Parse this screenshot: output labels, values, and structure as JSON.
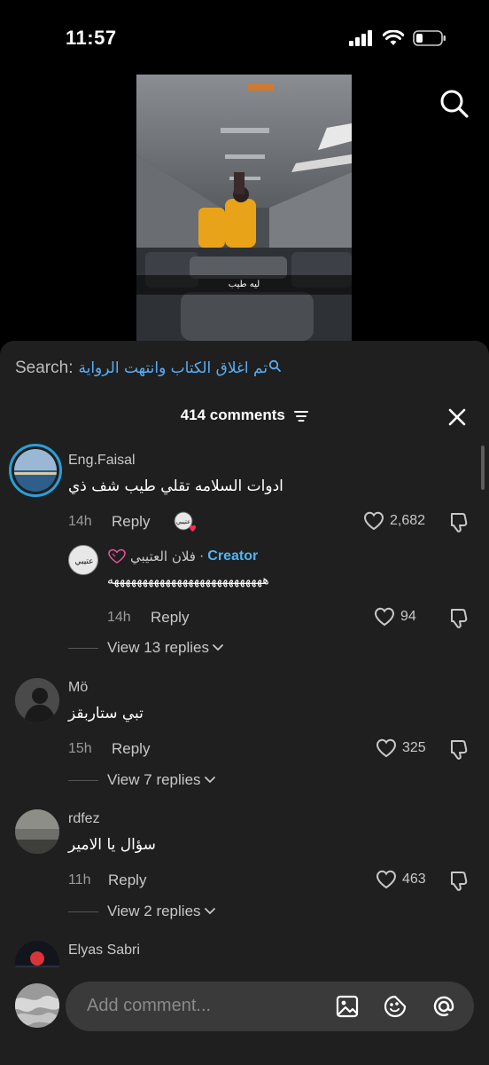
{
  "status": {
    "time": "11:57"
  },
  "video": {
    "caption": "ليه طيب"
  },
  "search": {
    "label": "Search:",
    "query": "تم اغلاق الكتاب وانتهت الرواية"
  },
  "header": {
    "count_label": "414 comments"
  },
  "comments": [
    {
      "username": "Eng.Faisal",
      "text": "ادوات السلامه تقلي طيب شف ذي",
      "time": "14h",
      "reply_label": "Reply",
      "likes": "2,682",
      "reply": {
        "username": "فلان العتيبي",
        "separator": "·",
        "creator_label": "Creator",
        "text": "هههههههههههههههههههههههههههه",
        "time": "14h",
        "reply_label": "Reply",
        "likes": "94"
      },
      "view_replies": "View 13 replies"
    },
    {
      "username": "Mö",
      "text": "تبي ستاربقز",
      "time": "15h",
      "reply_label": "Reply",
      "likes": "325",
      "view_replies": "View 7 replies"
    },
    {
      "username": "rdfez",
      "text": "سؤال يا الامير",
      "time": "11h",
      "reply_label": "Reply",
      "likes": "463",
      "view_replies": "View 2 replies"
    },
    {
      "username": "Elyas Sabri"
    }
  ],
  "input": {
    "placeholder": "Add comment..."
  },
  "colors": {
    "sheet_bg": "#1f1f1f",
    "link_blue": "#5aaef5",
    "creator_blue": "#4fb4f2",
    "heart_red": "#fe2c55"
  },
  "icons": [
    "search-icon",
    "filter-icon",
    "close-icon",
    "heart-icon",
    "dislike-icon",
    "chevron-down-icon",
    "image-icon",
    "emoji-icon",
    "mention-icon"
  ]
}
